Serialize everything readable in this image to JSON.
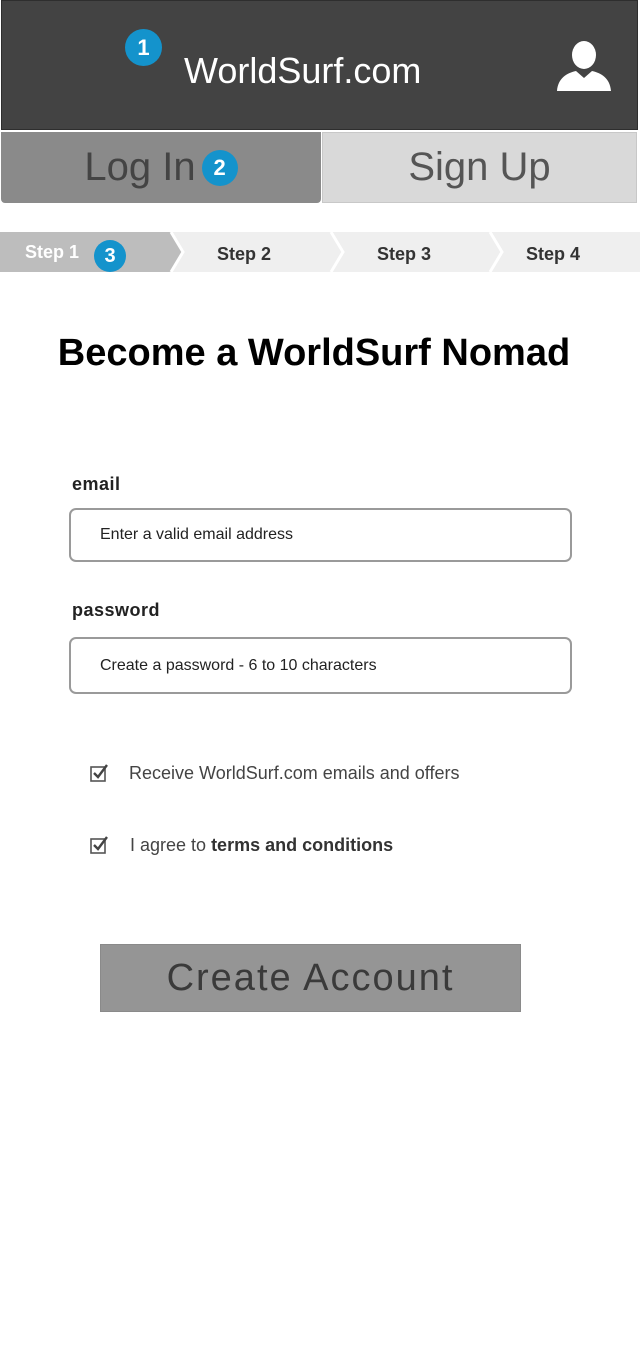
{
  "header": {
    "site_title": "WorldSurf.com",
    "markers": [
      "1",
      "2",
      "3"
    ],
    "user_icon": "user-silhouette-icon"
  },
  "auth_tabs": {
    "login_label": "Log In",
    "signup_label": "Sign Up",
    "active": "login"
  },
  "stepper": {
    "steps": [
      "Step 1",
      "Step 2",
      "Step 3",
      "Step 4"
    ],
    "current": 1
  },
  "form": {
    "title": "Become a WorldSurf Nomad",
    "email_label": "email",
    "email_placeholder": "Enter a valid email address",
    "password_label": "password",
    "password_placeholder": "Create a password - 6 to 10 characters",
    "offers_label": "Receive WorldSurf.com emails and offers",
    "offers_checked": true,
    "terms_prefix": "I agree to ",
    "terms_link": "terms and conditions",
    "terms_checked": true,
    "submit_label": "Create Account"
  },
  "colors": {
    "header_bg": "#434343",
    "marker": "#1493cc",
    "tab_active": "#8a8a8a",
    "tab_inactive": "#d9d9d9",
    "step_active": "#bdbdbd",
    "step_inactive": "#efefef",
    "button": "#959595"
  }
}
